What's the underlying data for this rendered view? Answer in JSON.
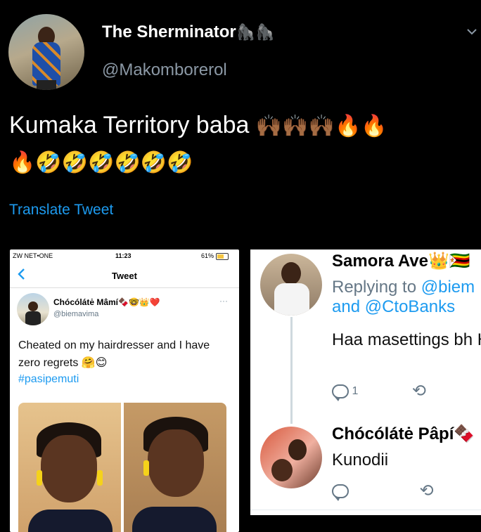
{
  "header": {
    "display_name": "The Sherminator",
    "name_emojis": [
      "🦍",
      "🦍"
    ],
    "handle": "@Makomborerol",
    "menu_icon": "chevron-down-icon"
  },
  "tweet": {
    "text": "Kumaka Territory baba",
    "emojis_line1": [
      "🙌🏾",
      "🙌🏾",
      "🙌🏾",
      "🔥",
      "🔥"
    ],
    "emojis_line2": [
      "🔥",
      "🤣",
      "🤣",
      "🤣",
      "🤣",
      "🤣",
      "🤣"
    ],
    "translate_label": "Translate Tweet"
  },
  "left_screenshot": {
    "status": {
      "carrier": "ZW NET•ONE",
      "time": "11:23",
      "battery": "61%"
    },
    "nav_title": "Tweet",
    "back_icon": "chevron-left-icon",
    "author_name": "Chócólátė Mâmí🍫🤓👑❤️",
    "author_handle": "@biemavima",
    "more_label": "···",
    "text": "Cheated on my hairdresser and I have zero regrets 🤗😊",
    "hashtag": "#pasipemuti"
  },
  "right_screenshot": {
    "reply1": {
      "name": "Samora Ave👑🇿🇼",
      "replying_prefix": "Replying to",
      "replying_to1": "@biem",
      "and_label": "and",
      "replying_to2": "@CtoBanks",
      "text": "Haa masettings bh Hut",
      "reply_count": "1"
    },
    "reply2": {
      "name": "Chócólátė Pâpí🍫",
      "text": "Kunodii"
    }
  },
  "colors": {
    "background": "#000000",
    "link": "#1d9bf0",
    "secondary_text": "#8b98a5"
  }
}
